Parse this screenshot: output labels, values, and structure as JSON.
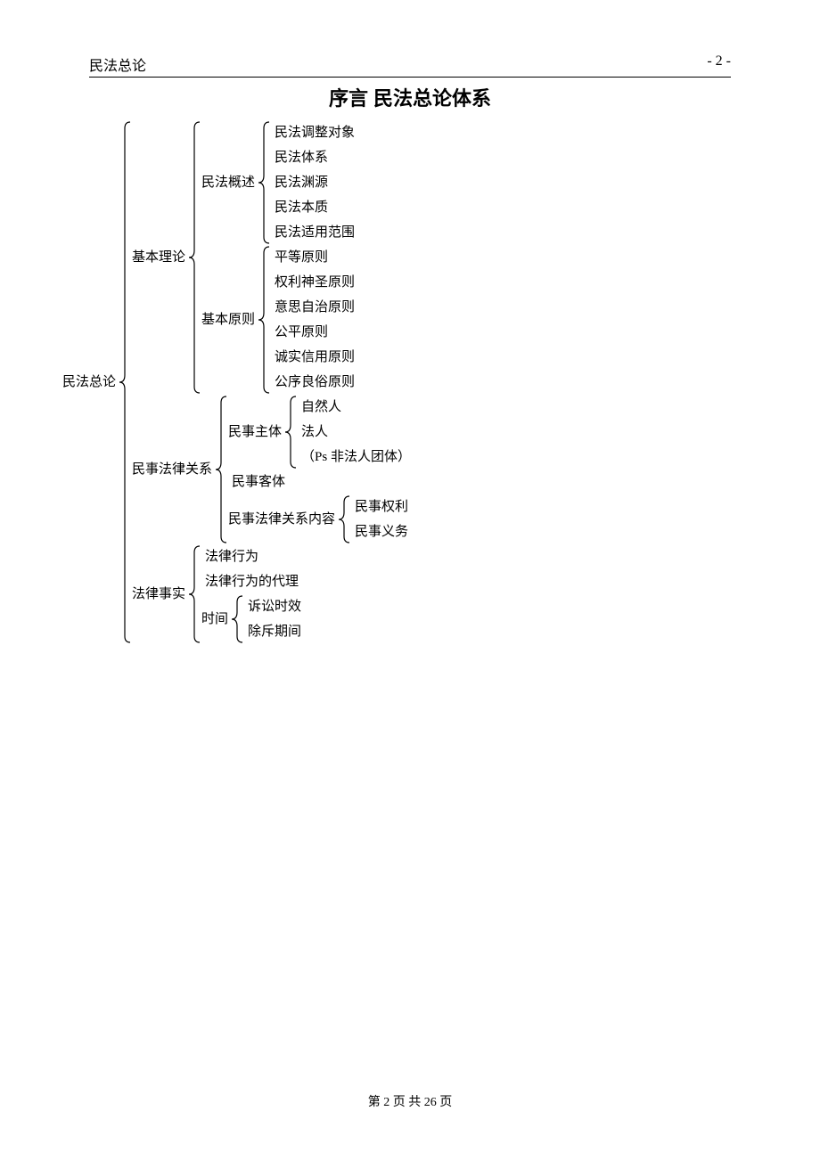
{
  "header": {
    "left": "民法总论",
    "right": "- 2 -"
  },
  "title": "序言  民法总论体系",
  "tree": {
    "label": "民法总论",
    "children": [
      {
        "label": "基本理论",
        "children": [
          {
            "label": "民法概述",
            "children": [
              {
                "label": "民法调整对象"
              },
              {
                "label": "民法体系"
              },
              {
                "label": "民法渊源"
              },
              {
                "label": "民法本质"
              },
              {
                "label": "民法适用范围"
              }
            ]
          },
          {
            "label": "基本原则",
            "children": [
              {
                "label": "平等原则"
              },
              {
                "label": "权利神圣原则"
              },
              {
                "label": "意思自治原则"
              },
              {
                "label": "公平原则"
              },
              {
                "label": "诚实信用原则"
              },
              {
                "label": "公序良俗原则"
              }
            ]
          }
        ]
      },
      {
        "label": "民事法律关系",
        "children": [
          {
            "label": "民事主体",
            "children": [
              {
                "label": "自然人"
              },
              {
                "label": "法人"
              },
              {
                "label": "（Ps  非法人团体）"
              }
            ]
          },
          {
            "label": "民事客体"
          },
          {
            "label": "民事法律关系内容",
            "children": [
              {
                "label": "民事权利"
              },
              {
                "label": "民事义务"
              }
            ]
          }
        ]
      },
      {
        "label": "法律事实",
        "children": [
          {
            "label": "法律行为"
          },
          {
            "label": "法律行为的代理"
          },
          {
            "label": "时间",
            "children": [
              {
                "label": "诉讼时效"
              },
              {
                "label": "除斥期间"
              }
            ]
          }
        ]
      }
    ]
  },
  "footer": {
    "prefix": "第",
    "page": "2",
    "mid": "页 共",
    "total": "26",
    "suffix": "页"
  }
}
